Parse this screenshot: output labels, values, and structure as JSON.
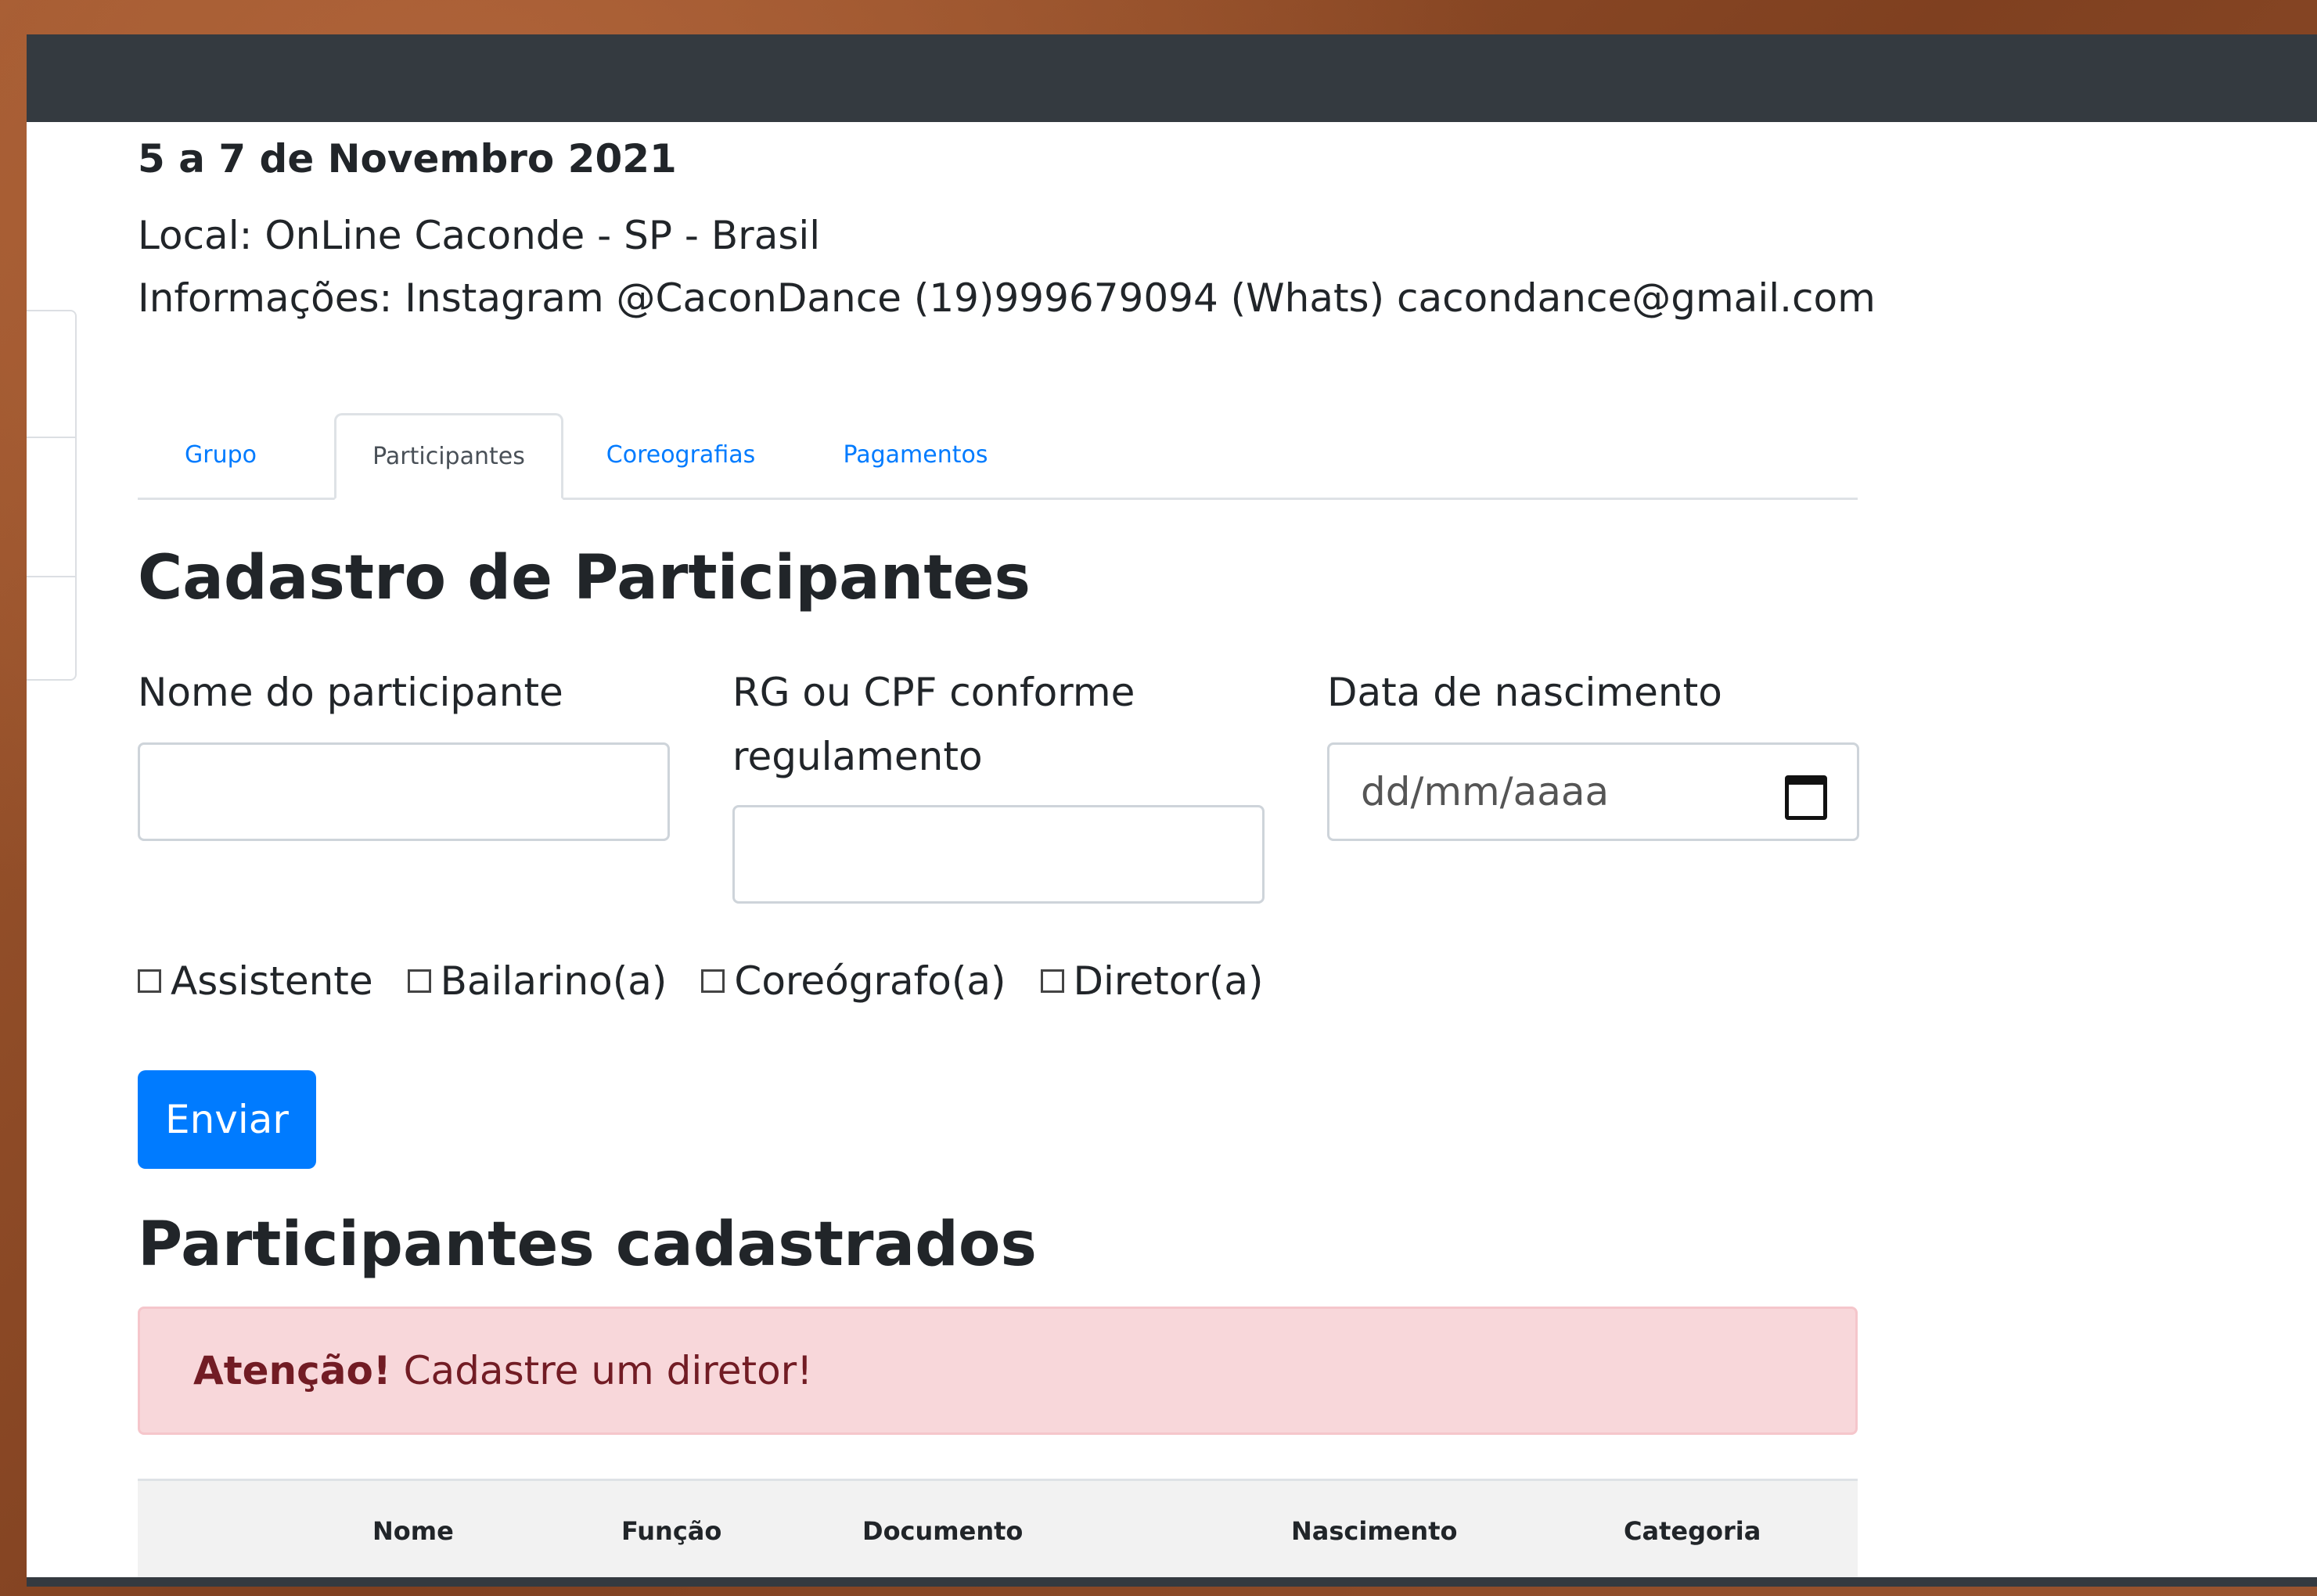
{
  "event": {
    "date": "5 a 7 de Novembro 2021",
    "local": "Local: OnLine Caconde - SP - Brasil",
    "contact": "Informações: Instagram @CaconDance (19)999679094 (Whats) cacondance@gmail.com"
  },
  "tabs": [
    {
      "label": "Grupo",
      "active": false
    },
    {
      "label": "Participantes",
      "active": true
    },
    {
      "label": "Coreografias",
      "active": false
    },
    {
      "label": "Pagamentos",
      "active": false
    }
  ],
  "form": {
    "title": "Cadastro de Participantes",
    "name_label": "Nome do participante",
    "name_value": "",
    "doc_label": "RG ou CPF conforme regulamento",
    "doc_value": "",
    "birth_label": "Data de nascimento",
    "birth_placeholder": "dd/mm/aaaa",
    "roles": [
      {
        "label": "Assistente",
        "checked": false
      },
      {
        "label": "Bailarino(a)",
        "checked": false
      },
      {
        "label": "Coreógrafo(a)",
        "checked": false
      },
      {
        "label": "Diretor(a)",
        "checked": false
      }
    ],
    "submit_label": "Enviar"
  },
  "list": {
    "title": "Participantes cadastrados",
    "alert_strong": "Atenção!",
    "alert_text": "Cadastre um diretor!",
    "columns": [
      "Nome",
      "Função",
      "Documento",
      "Nascimento",
      "Categoria"
    ]
  },
  "icons": {
    "calendar": "calendar-icon"
  },
  "colors": {
    "topbar": "#343a40",
    "primary": "#007bff",
    "alert_bg": "#f8d7da",
    "alert_text": "#721c24"
  }
}
